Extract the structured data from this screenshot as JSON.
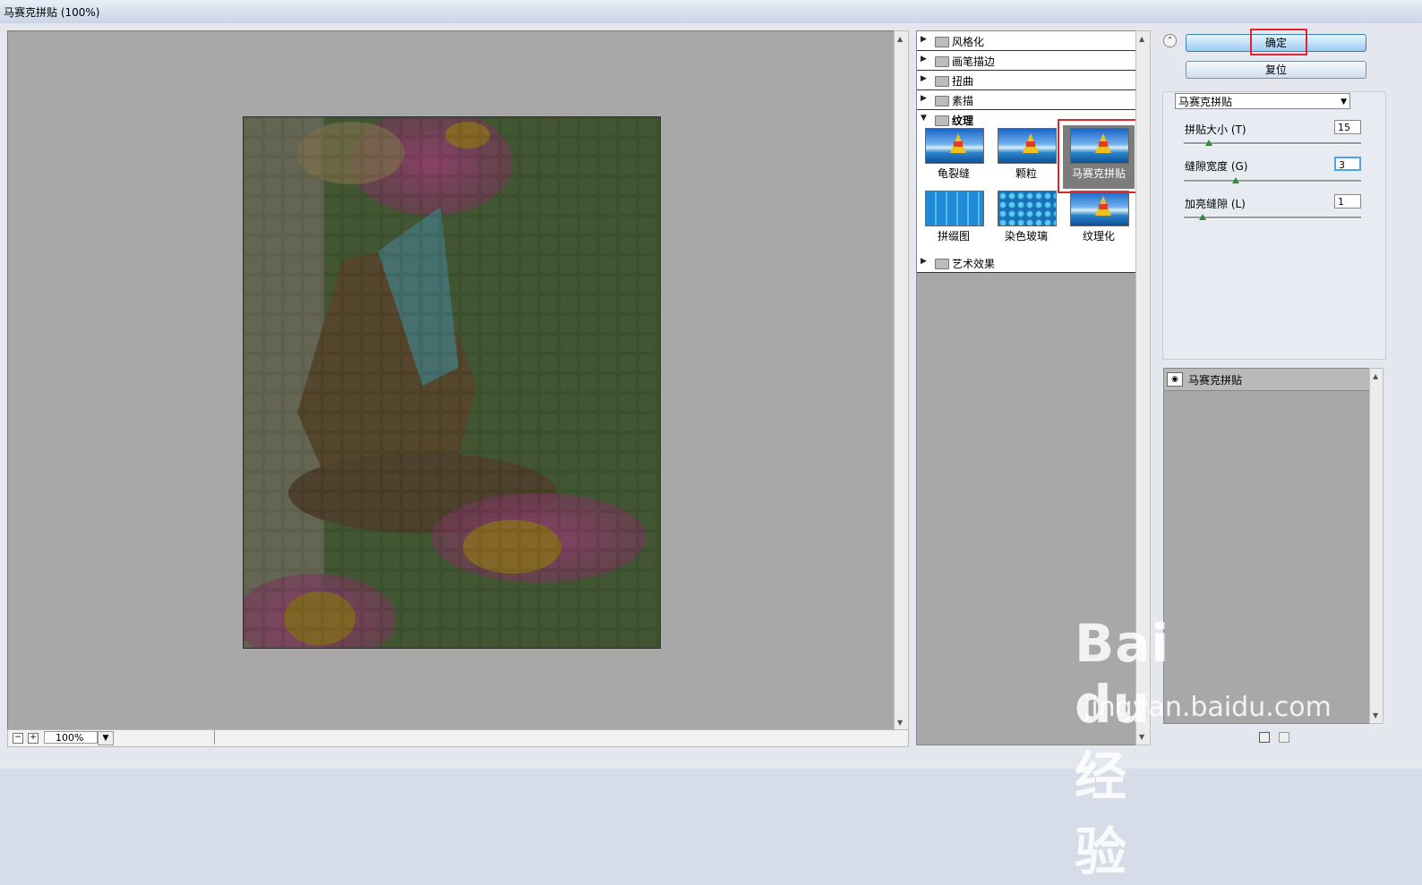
{
  "window": {
    "title": "马赛克拼贴 (100%)"
  },
  "preview": {
    "zoom": "100%"
  },
  "filter_gallery": {
    "categories": [
      {
        "label": "风格化",
        "expanded": false
      },
      {
        "label": "画笔描边",
        "expanded": false
      },
      {
        "label": "扭曲",
        "expanded": false
      },
      {
        "label": "素描",
        "expanded": false
      },
      {
        "label": "纹理",
        "expanded": true
      },
      {
        "label": "艺术效果",
        "expanded": false
      }
    ],
    "texture_filters": [
      "龟裂缝",
      "颗粒",
      "马赛克拼贴",
      "拼缀图",
      "染色玻璃",
      "纹理化"
    ],
    "selected_filter": "马赛克拼贴"
  },
  "buttons": {
    "ok": "确定",
    "reset": "复位"
  },
  "settings": {
    "filter_select": "马赛克拼贴",
    "params": [
      {
        "label": "拼贴大小 (T)",
        "value": "15",
        "slider_fraction": 0.14
      },
      {
        "label": "缝隙宽度 (G)",
        "value": "3",
        "slider_fraction": 0.3
      },
      {
        "label": "加亮缝隙 (L)",
        "value": "1",
        "slider_fraction": 0.1
      }
    ]
  },
  "layers": [
    {
      "label": "马赛克拼贴",
      "visible": true
    }
  ],
  "watermark": {
    "brand": "Bai du 经验",
    "url": "jingyan.baidu.com"
  },
  "colors": {
    "highlight_red": "#e0242b",
    "panel_gray": "#a8a8a8"
  }
}
